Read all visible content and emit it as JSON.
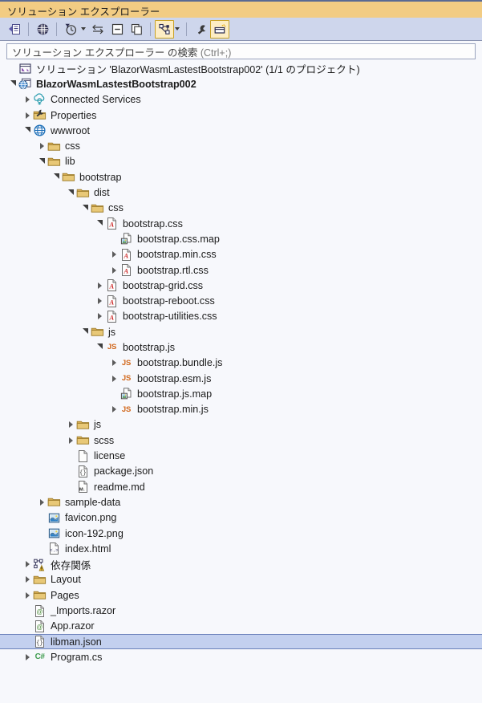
{
  "window": {
    "title": "ソリューション エクスプローラー"
  },
  "toolbar": {
    "buttons": [
      {
        "name": "home-button",
        "icon": "home-icon",
        "state": "normal"
      },
      {
        "name": "web-preview-button",
        "icon": "globe-grid-icon",
        "state": "normal"
      },
      {
        "name": "pending-changes-button",
        "icon": "clock-filter-icon",
        "state": "normal",
        "dropdown": true
      },
      {
        "name": "sync-with-active-document-button",
        "icon": "sync-arrows-icon",
        "state": "normal"
      },
      {
        "name": "collapse-all-button",
        "icon": "collapse-all-icon",
        "state": "normal"
      },
      {
        "name": "show-all-files-button",
        "icon": "show-all-files-icon",
        "state": "normal"
      },
      {
        "name": "view-class-diagram-button",
        "icon": "class-diagram-icon",
        "state": "active",
        "dropdown": true
      },
      {
        "name": "properties-button",
        "icon": "wrench-icon",
        "state": "normal"
      },
      {
        "name": "preview-selected-items-button",
        "icon": "preview-window-icon",
        "state": "active"
      }
    ]
  },
  "search": {
    "placeholder_main": "ソリューション エクスプローラー の検索",
    "placeholder_hint": "(Ctrl+;)",
    "value": ""
  },
  "tree": {
    "nodes": [
      {
        "depth": 0,
        "expander": "none",
        "icon": "solution-icon",
        "label": "ソリューション 'BlazorWasmLastestBootstrap002' (1/1 のプロジェクト)",
        "bold": false,
        "selected": false
      },
      {
        "depth": 0,
        "expander": "open",
        "icon": "blazor-project-icon",
        "label": "BlazorWasmLastestBootstrap002",
        "bold": true,
        "selected": false
      },
      {
        "depth": 1,
        "expander": "closed",
        "icon": "connected-services-icon",
        "label": "Connected Services",
        "bold": false,
        "selected": false
      },
      {
        "depth": 1,
        "expander": "closed",
        "icon": "properties-icon",
        "label": "Properties",
        "bold": false,
        "selected": false
      },
      {
        "depth": 1,
        "expander": "open",
        "icon": "wwwroot-icon",
        "label": "wwwroot",
        "bold": false,
        "selected": false
      },
      {
        "depth": 2,
        "expander": "closed",
        "icon": "folder-icon",
        "label": "css",
        "bold": false,
        "selected": false
      },
      {
        "depth": 2,
        "expander": "open",
        "icon": "folder-icon",
        "label": "lib",
        "bold": false,
        "selected": false
      },
      {
        "depth": 3,
        "expander": "open",
        "icon": "folder-icon",
        "label": "bootstrap",
        "bold": false,
        "selected": false
      },
      {
        "depth": 4,
        "expander": "open",
        "icon": "folder-icon",
        "label": "dist",
        "bold": false,
        "selected": false
      },
      {
        "depth": 5,
        "expander": "open",
        "icon": "folder-icon",
        "label": "css",
        "bold": false,
        "selected": false
      },
      {
        "depth": 6,
        "expander": "open",
        "icon": "css-file-icon",
        "label": "bootstrap.css",
        "bold": false,
        "selected": false
      },
      {
        "depth": 7,
        "expander": "none",
        "icon": "map-file-icon",
        "label": "bootstrap.css.map",
        "bold": false,
        "selected": false
      },
      {
        "depth": 7,
        "expander": "closed",
        "icon": "css-file-icon",
        "label": "bootstrap.min.css",
        "bold": false,
        "selected": false
      },
      {
        "depth": 7,
        "expander": "closed",
        "icon": "css-file-icon",
        "label": "bootstrap.rtl.css",
        "bold": false,
        "selected": false
      },
      {
        "depth": 6,
        "expander": "closed",
        "icon": "css-file-icon",
        "label": "bootstrap-grid.css",
        "bold": false,
        "selected": false
      },
      {
        "depth": 6,
        "expander": "closed",
        "icon": "css-file-icon",
        "label": "bootstrap-reboot.css",
        "bold": false,
        "selected": false
      },
      {
        "depth": 6,
        "expander": "closed",
        "icon": "css-file-icon",
        "label": "bootstrap-utilities.css",
        "bold": false,
        "selected": false
      },
      {
        "depth": 5,
        "expander": "open",
        "icon": "folder-icon",
        "label": "js",
        "bold": false,
        "selected": false
      },
      {
        "depth": 6,
        "expander": "open",
        "icon": "js-file-icon",
        "label": "bootstrap.js",
        "bold": false,
        "selected": false
      },
      {
        "depth": 7,
        "expander": "closed",
        "icon": "js-file-icon",
        "label": "bootstrap.bundle.js",
        "bold": false,
        "selected": false
      },
      {
        "depth": 7,
        "expander": "closed",
        "icon": "js-file-icon",
        "label": "bootstrap.esm.js",
        "bold": false,
        "selected": false
      },
      {
        "depth": 7,
        "expander": "none",
        "icon": "map-file-icon",
        "label": "bootstrap.js.map",
        "bold": false,
        "selected": false
      },
      {
        "depth": 7,
        "expander": "closed",
        "icon": "js-file-icon",
        "label": "bootstrap.min.js",
        "bold": false,
        "selected": false
      },
      {
        "depth": 4,
        "expander": "closed",
        "icon": "folder-icon",
        "label": "js",
        "bold": false,
        "selected": false
      },
      {
        "depth": 4,
        "expander": "closed",
        "icon": "folder-icon",
        "label": "scss",
        "bold": false,
        "selected": false
      },
      {
        "depth": 4,
        "expander": "none",
        "icon": "blank-file-icon",
        "label": "license",
        "bold": false,
        "selected": false
      },
      {
        "depth": 4,
        "expander": "none",
        "icon": "json-file-icon",
        "label": "package.json",
        "bold": false,
        "selected": false
      },
      {
        "depth": 4,
        "expander": "none",
        "icon": "markdown-file-icon",
        "label": "readme.md",
        "bold": false,
        "selected": false
      },
      {
        "depth": 2,
        "expander": "closed",
        "icon": "folder-icon",
        "label": "sample-data",
        "bold": false,
        "selected": false
      },
      {
        "depth": 2,
        "expander": "none",
        "icon": "image-file-icon",
        "label": "favicon.png",
        "bold": false,
        "selected": false
      },
      {
        "depth": 2,
        "expander": "none",
        "icon": "image-file-icon",
        "label": "icon-192.png",
        "bold": false,
        "selected": false
      },
      {
        "depth": 2,
        "expander": "none",
        "icon": "html-file-icon",
        "label": "index.html",
        "bold": false,
        "selected": false
      },
      {
        "depth": 1,
        "expander": "closed",
        "icon": "dependencies-warning-icon",
        "label": "依存関係",
        "bold": false,
        "selected": false
      },
      {
        "depth": 1,
        "expander": "closed",
        "icon": "folder-icon",
        "label": "Layout",
        "bold": false,
        "selected": false
      },
      {
        "depth": 1,
        "expander": "closed",
        "icon": "folder-icon",
        "label": "Pages",
        "bold": false,
        "selected": false
      },
      {
        "depth": 1,
        "expander": "none",
        "icon": "razor-file-icon",
        "label": "_Imports.razor",
        "bold": false,
        "selected": false
      },
      {
        "depth": 1,
        "expander": "none",
        "icon": "razor-file-icon",
        "label": "App.razor",
        "bold": false,
        "selected": false
      },
      {
        "depth": 1,
        "expander": "none",
        "icon": "json-file-icon",
        "label": "libman.json",
        "bold": false,
        "selected": true
      },
      {
        "depth": 1,
        "expander": "closed",
        "icon": "csharp-file-icon",
        "label": "Program.cs",
        "bold": false,
        "selected": false
      }
    ]
  },
  "colors": {
    "titlebar_bg": "#f2cc83",
    "toolbar_bg": "#ced6ec",
    "tree_bg": "#f7f8fc",
    "left_strip": "#5a6a93",
    "selection_bg": "#c3d0ef",
    "selection_border": "#6b81ba",
    "folder": "#d4aa52",
    "css_accent": "#cc2222",
    "js_accent": "#d1671b",
    "csharp_accent": "#3f9c4f"
  }
}
